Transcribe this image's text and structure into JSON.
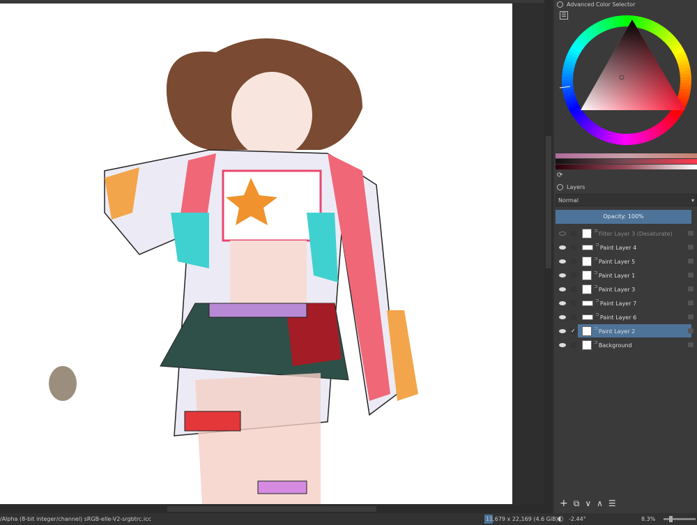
{
  "color_selector": {
    "title": "Advanced Color Selector",
    "menu_icon": "list-icon",
    "refresh_icon": "refresh-icon"
  },
  "layers": {
    "title": "Layers",
    "blend_mode": "Normal",
    "opacity_label": "Opacity:  100%",
    "items": [
      {
        "name": "Filter Layer 3 (Desaturate)",
        "visible": false,
        "selected": false
      },
      {
        "name": "Paint Layer 4",
        "visible": true,
        "selected": false
      },
      {
        "name": "Paint Layer 5",
        "visible": true,
        "selected": false
      },
      {
        "name": "Paint Layer 1",
        "visible": true,
        "selected": false
      },
      {
        "name": "Paint Layer 3",
        "visible": true,
        "selected": false
      },
      {
        "name": "Paint Layer 7",
        "visible": true,
        "selected": false
      },
      {
        "name": "Paint Layer 6",
        "visible": true,
        "selected": false
      },
      {
        "name": "Paint Layer 2",
        "visible": true,
        "selected": true
      },
      {
        "name": "Background",
        "visible": true,
        "selected": false
      }
    ],
    "tools": {
      "add": "+",
      "duplicate": "⧉",
      "down": "∨",
      "up": "∧",
      "properties": "☰"
    }
  },
  "status": {
    "colorspace": "/Alpha (8-bit integer/channel)  sRGB-elle-V2-srgbtrc.icc",
    "size": "11,679 x 22,169 (4.6 GiB)",
    "rotation": "-2.44°",
    "zoom": "8.3%"
  },
  "colors": {
    "accent": "#4e7399",
    "current_color": "#c9a0a8"
  }
}
